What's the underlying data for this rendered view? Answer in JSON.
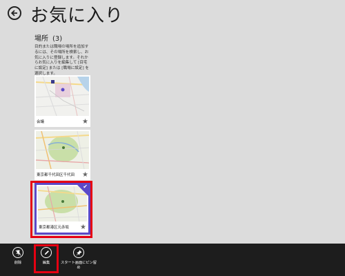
{
  "header": {
    "title": "お気に入り"
  },
  "section": {
    "name": "場所",
    "count": "(3)",
    "description": "目的または職場の場所を追加するには、その場所を検索し、お気に入りに登録します。それからお気に入りを編集して [目宅に設定] または [職場に設定] を選択します。"
  },
  "favorites": [
    {
      "label": "会議",
      "selected": false
    },
    {
      "label": "東京都千代田区千代田",
      "selected": false
    },
    {
      "label": "東京都港区元赤坂",
      "selected": true
    }
  ],
  "app_bar": {
    "delete_label": "削除",
    "edit_label": "編集",
    "pin_label": "スタート画面にピン留め"
  },
  "colors": {
    "accent": "#5b49c8",
    "highlight": "#e60012",
    "app_bar_bg": "#1d1d1d"
  }
}
